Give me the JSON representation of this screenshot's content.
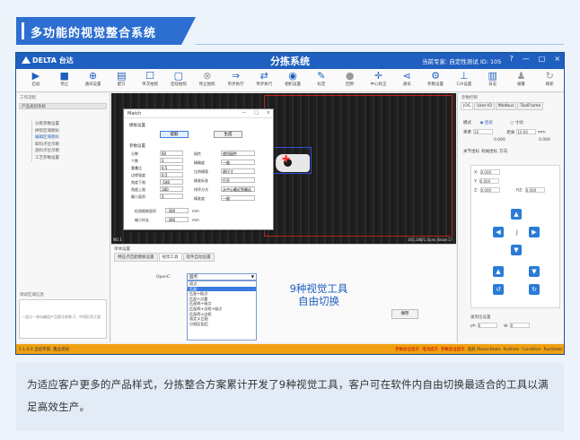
{
  "banner": {
    "title": "多功能的视觉整合系统"
  },
  "app": {
    "logo": "DELTA 台达",
    "title": "分拣系统",
    "user_info": "当前专家: 自定性测试 ID: 105",
    "window_controls": [
      "?",
      "—",
      "□",
      "×"
    ]
  },
  "toolbar": [
    {
      "label": "启动",
      "icon": "play-icon"
    },
    {
      "label": "停止",
      "icon": "stop-icon"
    },
    {
      "label": "通讯设置",
      "icon": "globe-icon"
    },
    {
      "label": "配方",
      "icon": "recipe-icon"
    },
    {
      "label": "单次拍照",
      "icon": "frame-icon"
    },
    {
      "label": "连续拍照",
      "icon": "frame-icon"
    },
    {
      "label": "停止拍照",
      "icon": "cancel-icon"
    },
    {
      "label": "单步执行",
      "icon": "arrow-right-icon"
    },
    {
      "label": "单步执行",
      "icon": "double-arrow-icon"
    },
    {
      "label": "相机设置",
      "icon": "camera-icon"
    },
    {
      "label": "标定",
      "icon": "marker-icon"
    },
    {
      "label": "回原",
      "icon": "home-icon"
    },
    {
      "label": "中心校正",
      "icon": "crosshair-icon"
    },
    {
      "label": "通讯",
      "icon": "share-icon"
    },
    {
      "label": "参数设置",
      "icon": "search-settings-icon"
    },
    {
      "label": "C/A设置",
      "icon": "axis-icon"
    },
    {
      "label": "日志",
      "icon": "log-icon"
    },
    {
      "label": "报警",
      "icon": "alarm-icon"
    },
    {
      "label": "刷新",
      "icon": "refresh-icon"
    }
  ],
  "left_panel": {
    "section": "工作流程",
    "header": "产品类别系统",
    "tree": [
      "分拣参数设置",
      "拼装区域图标",
      "编辑区域图标",
      "取料点位示教",
      "放料点位示教",
      "工艺参数设置"
    ],
    "bottom_title": "调试区域信息",
    "bottom_text": "一组方一参料编组产品图号参数-2，中线形状正面"
  },
  "dialog": {
    "title": "Match",
    "section1": "模板设置",
    "btn_pick": "提取",
    "btn_save": "生成",
    "section2": "参数设置",
    "left_params": [
      {
        "label": "分数",
        "value": "60"
      },
      {
        "label": "个数",
        "value": "2"
      },
      {
        "label": "重叠比",
        "value": "0.5"
      },
      {
        "label": "边缘强度",
        "value": "0.5"
      },
      {
        "label": "角度下限",
        "value": "-180"
      },
      {
        "label": "角度上限",
        "value": "180"
      },
      {
        "label": "最小面积",
        "value": "5"
      }
    ],
    "right_params": [
      {
        "label": "极性",
        "value": "使用极性"
      },
      {
        "label": "精确度",
        "value": "一般"
      },
      {
        "label": "比例模版",
        "value": "原尺寸"
      },
      {
        "label": "精准标准",
        "value": "打开"
      },
      {
        "label": "排序方式",
        "value": "从中心最近到最远"
      },
      {
        "label": "精准度",
        "value": "一般"
      }
    ],
    "bottom_params": [
      {
        "label": "检测限制面积",
        "value": "-300",
        "unit": "mm"
      },
      {
        "label": "缩小时长",
        "value": "-300",
        "unit": "mm"
      }
    ]
  },
  "canvas": {
    "no_label": "NO.1",
    "coord": "165,180/1,Scan,Value:17"
  },
  "lower": {
    "label": "单体设置",
    "tabs": [
      "特征点匹配模板设置",
      "视觉工具",
      "软件自动设置"
    ],
    "active_tab": 1,
    "option_label": "OpenC:",
    "selected": "固点",
    "options": [
      "固点",
      "匹配",
      "匹配+极点",
      "匹配+点量",
      "匹配两+极点",
      "匹配两+边框+极点",
      "匹配两+边框",
      "画定义匹配",
      "分割区配匹"
    ],
    "callout_line1": "9种视觉工具",
    "callout_line2": "自由切换",
    "save_button": "保存"
  },
  "right_panel": {
    "header": "参数控制",
    "tabs": [
      "JOG",
      "User IO",
      "Modbus",
      "ToolFrame"
    ],
    "mode_label": "模式",
    "mode_opt1": "连续",
    "mode_opt2": "寸动",
    "speed_label": "速度",
    "speed_value": "10",
    "dist_label": "距离",
    "dist_value": "10.00",
    "dist_unit": "mm",
    "val1": "0.000",
    "val2": "0.000",
    "subtabs": [
      "关节坐标",
      "机械坐标",
      "方向"
    ],
    "coords": [
      {
        "label": "X:",
        "value": "0.000"
      },
      {
        "label": "Y:",
        "value": "0.000"
      },
      {
        "label": "Z:",
        "value": "0.000"
      },
      {
        "label": "RZ:",
        "value": "0.000"
      }
    ],
    "jog_mid": "J",
    "bottom_label": "速到位设置",
    "bottom_fields": [
      {
        "label": "ph",
        "value": "0"
      },
      {
        "label": "W",
        "value": "0"
      }
    ]
  },
  "status": {
    "left": "1.1.0.0  当前专家: 鑫业测试",
    "right_red": "参数验证提示",
    "right_a": "电流提示",
    "right_b": "参数验证提示",
    "right_c": "电机 ",
    "right_d": "MasonState",
    "right_e": "RxState",
    "right_f": "Condition",
    "right_g": "RunState"
  },
  "caption": {
    "text": "为适应客户更多的产品样式，分拣整合方案累计开发了9种视觉工具，客户可在软件内自由切换最适合的工具以满足高效生产。"
  }
}
